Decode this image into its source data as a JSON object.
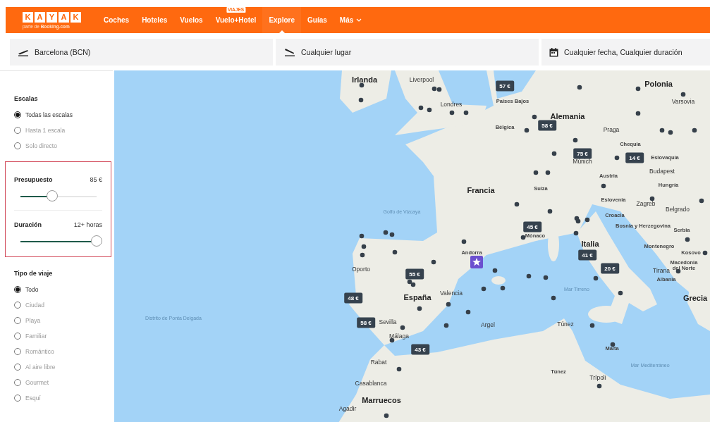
{
  "header": {
    "logo_letters": [
      "K",
      "A",
      "Y",
      "A",
      "K"
    ],
    "logo_tagline": "parte de **Booking.com**",
    "nav": [
      {
        "label": "Coches",
        "selected": false
      },
      {
        "label": "Hoteles",
        "selected": false
      },
      {
        "label": "Vuelos",
        "selected": false
      },
      {
        "label": "Vuelo+Hotel",
        "badge": "VIAJES",
        "selected": false
      },
      {
        "label": "Explore",
        "selected": true
      },
      {
        "label": "Guías",
        "selected": false
      },
      {
        "label": "Más",
        "dropdown": true,
        "selected": false
      }
    ]
  },
  "search": [
    {
      "kind": "origin",
      "value": "Barcelona (BCN)"
    },
    {
      "kind": "destination",
      "value": "Cualquier lugar"
    },
    {
      "kind": "dates",
      "value": "Cualquier fecha, Cualquier duración"
    }
  ],
  "filters": {
    "stops": {
      "title": "Escalas",
      "options": [
        {
          "label": "Todas las escalas",
          "selected": true
        },
        {
          "label": "Hasta 1 escala",
          "selected": false
        },
        {
          "label": "Solo directo",
          "selected": false
        }
      ]
    },
    "budget": {
      "title": "Presupuesto",
      "reading": "85 €",
      "level": 0.42
    },
    "duration": {
      "title": "Duración",
      "reading": "12+ horas",
      "level": 1
    },
    "trip_type": {
      "title": "Tipo de viaje",
      "options": [
        {
          "label": "Todo",
          "selected": true
        },
        {
          "label": "Ciudad",
          "selected": false
        },
        {
          "label": "Playa",
          "selected": false
        },
        {
          "label": "Familiar",
          "selected": false
        },
        {
          "label": "Romántico",
          "selected": false
        },
        {
          "label": "Al aire libre",
          "selected": false
        },
        {
          "label": "Gourmet",
          "selected": false
        },
        {
          "label": "Esquí",
          "selected": false
        }
      ]
    }
  },
  "map": {
    "labels": [
      {
        "text": "Irlanda",
        "kind": "country"
      },
      {
        "text": "Liverpool",
        "kind": "city"
      },
      {
        "text": "Londres",
        "kind": "city"
      },
      {
        "text": "Países Bajos",
        "kind": "region"
      },
      {
        "text": "Bélgica",
        "kind": "region"
      },
      {
        "text": "Alemania",
        "kind": "country"
      },
      {
        "text": "Polonia",
        "kind": "country"
      },
      {
        "text": "Varsovia",
        "kind": "city"
      },
      {
        "text": "Chequia",
        "kind": "region"
      },
      {
        "text": "Eslovaquia",
        "kind": "region"
      },
      {
        "text": "Austria",
        "kind": "region"
      },
      {
        "text": "Hungría",
        "kind": "region"
      },
      {
        "text": "Francia",
        "kind": "country"
      },
      {
        "text": "Suiza",
        "kind": "region"
      },
      {
        "text": "Eslovenia",
        "kind": "region"
      },
      {
        "text": "Croacia",
        "kind": "region"
      },
      {
        "text": "Bosnia y Herzegovina",
        "kind": "region"
      },
      {
        "text": "Serbia",
        "kind": "region"
      },
      {
        "text": "Montenegro",
        "kind": "region"
      },
      {
        "text": "Kosovo",
        "kind": "region"
      },
      {
        "text": "Macedonia del Norte",
        "kind": "region"
      },
      {
        "text": "Albania",
        "kind": "region"
      },
      {
        "text": "Italia",
        "kind": "country"
      },
      {
        "text": "Andorra",
        "kind": "region"
      },
      {
        "text": "España",
        "kind": "country"
      },
      {
        "text": "Grecia",
        "kind": "country"
      },
      {
        "text": "Marruecos",
        "kind": "country"
      },
      {
        "text": "Argel",
        "kind": "city"
      },
      {
        "text": "Túnez",
        "kind": "city"
      },
      {
        "text": "Túnez",
        "kind": "region"
      },
      {
        "text": "Malta",
        "kind": "region"
      },
      {
        "text": "Trípoli",
        "kind": "city"
      },
      {
        "text": "Rabat",
        "kind": "city"
      },
      {
        "text": "Casablanca",
        "kind": "city"
      },
      {
        "text": "Agadir",
        "kind": "city"
      },
      {
        "text": "Oporto",
        "kind": "city"
      },
      {
        "text": "Valencia",
        "kind": "city"
      },
      {
        "text": "Málaga",
        "kind": "city"
      },
      {
        "text": "Sevilla",
        "kind": "city"
      },
      {
        "text": "Mónaco",
        "kind": "region"
      },
      {
        "text": "Múnich",
        "kind": "city"
      },
      {
        "text": "Praga",
        "kind": "city"
      },
      {
        "text": "Budapest",
        "kind": "city"
      },
      {
        "text": "Zagreb",
        "kind": "city"
      },
      {
        "text": "Belgrado",
        "kind": "city"
      },
      {
        "text": "Tirana",
        "kind": "city"
      },
      {
        "text": "Mar Tirreno",
        "kind": "sea"
      },
      {
        "text": "Mar Mediterráneo",
        "kind": "sea"
      },
      {
        "text": "Golfo de Vizcaya",
        "kind": "sea"
      },
      {
        "text": "Distrito de Ponta Delgada",
        "kind": "sea"
      }
    ],
    "price_pins": [
      {
        "price": "57 €"
      },
      {
        "price": "58 €"
      },
      {
        "price": "75 €"
      },
      {
        "price": "14 €"
      },
      {
        "price": "45 €"
      },
      {
        "price": "41 €"
      },
      {
        "price": "20 €"
      },
      {
        "price": "55 €"
      },
      {
        "price": "48 €"
      },
      {
        "price": "58 €"
      },
      {
        "price": "43 €"
      }
    ]
  }
}
